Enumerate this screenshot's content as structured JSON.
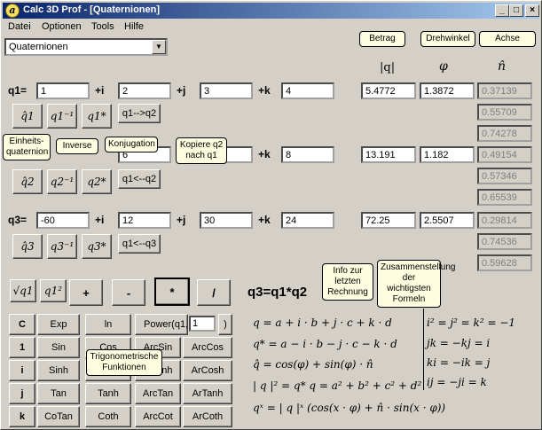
{
  "window": {
    "title": "Calc 3D Prof - [Quaternionen]",
    "icon": "app-icon",
    "min": "_",
    "max": "□",
    "close": "×"
  },
  "menu": [
    "Datei",
    "Optionen",
    "Tools",
    "Hilfe"
  ],
  "combo": {
    "value": "Quaternionen"
  },
  "headers": {
    "betrag": "Betrag",
    "drehwinkel": "Drehwinkel",
    "achse": "Achse",
    "q_abs": "|q|",
    "phi": "φ",
    "nhat": "n̂"
  },
  "q1": {
    "label": "q1=",
    "a": "1",
    "b": "2",
    "c": "3",
    "d": "4",
    "abs": "5.4772",
    "phi": "1.3872",
    "n": [
      "0.37139",
      "0.55709",
      "0.74278"
    ]
  },
  "q2": {
    "label": "q2=",
    "a": "",
    "b": "6",
    "c": "7",
    "d": "8",
    "abs": "13.191",
    "phi": "1.182",
    "n": [
      "0.49154",
      "0.57346",
      "0.65539"
    ]
  },
  "q3": {
    "label": "q3=",
    "a": "-60",
    "b": "12",
    "c": "30",
    "d": "24",
    "abs": "72.25",
    "phi": "2.5507",
    "n": [
      "0.29814",
      "0.74536",
      "0.59628"
    ]
  },
  "units": {
    "i": "+i",
    "j": "+j",
    "k": "+k"
  },
  "buttons": {
    "q1_to_q2": "q1-->q2",
    "q2_to_q1": "q1<--q2",
    "q3_to_q1": "q1<--q3",
    "unit1": "q̂1",
    "inv1": "q1⁻¹",
    "conj1": "q1*",
    "unit2": "q̂2",
    "inv2": "q2⁻¹",
    "conj2": "q2*",
    "unit3": "q̂3",
    "inv3": "q3⁻¹",
    "conj3": "q3*",
    "sqrt": "√q1",
    "sq": "q1²",
    "plus": "+",
    "minus": "-",
    "mul": "*",
    "div": "/"
  },
  "callouts": {
    "einheit": "Einheits-quaternion",
    "inverse": "Inverse",
    "konj": "Konjugation",
    "kopiere": "Kopiere q2 nach q1",
    "info": "Info zur letzten Rechnung",
    "zus": "Zusammenstellung der wichtigsten Formeln",
    "trig": "Trigonometrische Funktionen"
  },
  "result": "q3=q1*q2",
  "funcs": {
    "rows": [
      {
        "h": "C",
        "a": "Exp",
        "b": "ln",
        "c": "Power(q1,",
        "d": "1"
      },
      {
        "h": "1",
        "a": "Sin",
        "b": "Cos",
        "c": "ArcSin",
        "d": "ArcCos"
      },
      {
        "h": "i",
        "a": "Sinh",
        "b": "Cosh",
        "c": "ArSinh",
        "d": "ArCosh"
      },
      {
        "h": "j",
        "a": "Tan",
        "b": "Tanh",
        "c": "ArcTan",
        "d": "ArTanh"
      },
      {
        "h": "k",
        "a": "CoTan",
        "b": "Coth",
        "c": "ArcCot",
        "d": "ArCoth"
      }
    ]
  },
  "formulas": {
    "f1": "q = a + i · b + j · c + k · d",
    "f2": "q* = a − i · b − j · c − k · d",
    "f3": "q̂ = cos(φ) + sin(φ) · n̂",
    "f4": "| q |² = q* q = a² + b² + c² + d²",
    "f5": "qˣ = | q |ˣ (cos(x · φ) + n̂ · sin(x · φ))",
    "r1": "i² = j² = k² = −1",
    "r2": "jk = −kj = i",
    "r3": "ki = −ik = j",
    "r4": "ij = −ji = k"
  }
}
